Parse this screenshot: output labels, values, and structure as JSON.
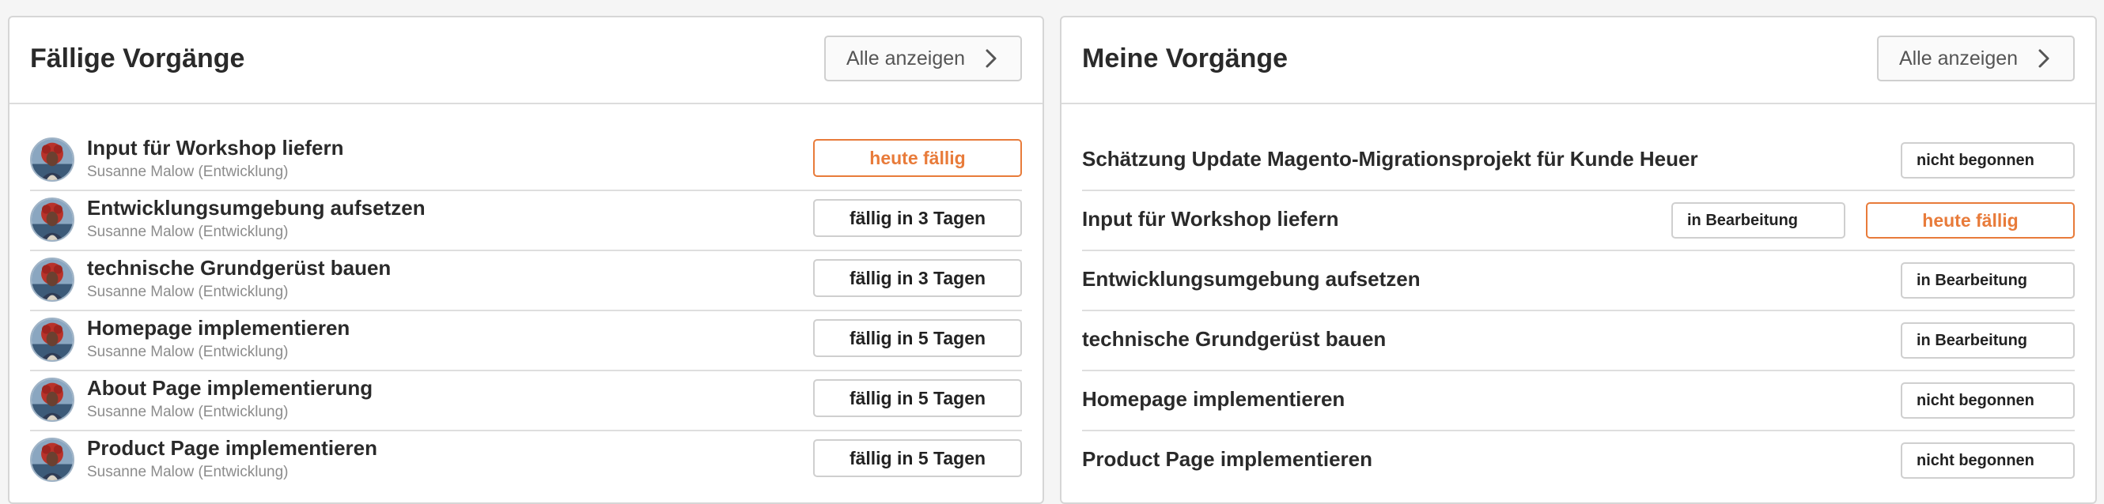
{
  "colors": {
    "accent": "#e87b3a",
    "border": "#cfcfcf",
    "text": "#2a2a2a",
    "muted": "#8c8c8c"
  },
  "left_panel": {
    "title": "Fällige Vorgänge",
    "show_all_label": "Alle anzeigen",
    "items": [
      {
        "title": "Input für Workshop liefern",
        "assignee": "Susanne Malow (Entwicklung)",
        "due": "heute fällig",
        "urgent": true
      },
      {
        "title": "Entwicklungsumgebung aufsetzen",
        "assignee": "Susanne Malow (Entwicklung)",
        "due": "fällig in 3 Tagen",
        "urgent": false
      },
      {
        "title": "technische Grundgerüst bauen",
        "assignee": "Susanne Malow (Entwicklung)",
        "due": "fällig in 3 Tagen",
        "urgent": false
      },
      {
        "title": "Homepage implementieren",
        "assignee": "Susanne Malow (Entwicklung)",
        "due": "fällig in 5 Tagen",
        "urgent": false
      },
      {
        "title": "About Page implementierung",
        "assignee": "Susanne Malow (Entwicklung)",
        "due": "fällig in 5 Tagen",
        "urgent": false
      },
      {
        "title": "Product Page implementieren",
        "assignee": "Susanne Malow (Entwicklung)",
        "due": "fällig in 5 Tagen",
        "urgent": false
      }
    ]
  },
  "right_panel": {
    "title": "Meine Vorgänge",
    "show_all_label": "Alle anzeigen",
    "items": [
      {
        "title": "Schätzung Update Magento-Migrationsprojekt für Kunde Heuer",
        "status": "nicht begonnen",
        "due": ""
      },
      {
        "title": "Input für Workshop liefern",
        "status": "in Bearbeitung",
        "due": "heute fällig"
      },
      {
        "title": "Entwicklungsumgebung aufsetzen",
        "status": "in Bearbeitung",
        "due": ""
      },
      {
        "title": "technische Grundgerüst bauen",
        "status": "in Bearbeitung",
        "due": ""
      },
      {
        "title": "Homepage implementieren",
        "status": "nicht begonnen",
        "due": ""
      },
      {
        "title": "Product Page implementieren",
        "status": "nicht begonnen",
        "due": ""
      }
    ]
  }
}
